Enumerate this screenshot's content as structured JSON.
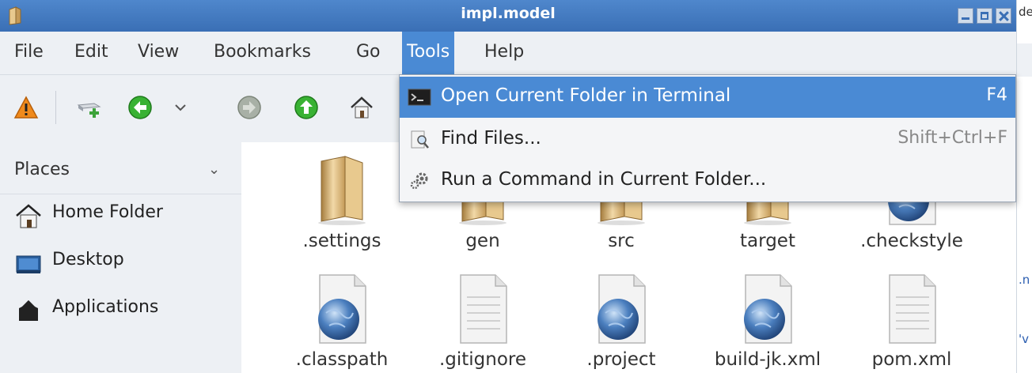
{
  "window": {
    "title": "impl.model"
  },
  "background_window": {
    "title_fragment": "de",
    "text_a": ".n",
    "text_b": "'v"
  },
  "menubar": {
    "items": [
      "File",
      "Edit",
      "View",
      "Bookmarks",
      "Go",
      "Tools",
      "Help"
    ],
    "active": "Tools"
  },
  "tools_menu": {
    "items": [
      {
        "label": "Open Current Folder in Terminal",
        "shortcut": "F4",
        "icon": "terminal-icon",
        "highlighted": true
      },
      {
        "label": "Find Files...",
        "shortcut": "Shift+Ctrl+F",
        "icon": "search-files-icon",
        "highlighted": false
      },
      {
        "label": "Run a Command in Current Folder...",
        "shortcut": "",
        "icon": "gear-icon",
        "highlighted": false
      }
    ]
  },
  "toolbar": {
    "icons": [
      "warning-icon",
      "new-tab-icon",
      "back-icon",
      "history-dropdown-icon",
      "forward-icon",
      "up-icon",
      "home-icon"
    ]
  },
  "sidebar": {
    "header": "Places",
    "items": [
      {
        "label": "Home Folder",
        "icon": "home-folder-icon"
      },
      {
        "label": "Desktop",
        "icon": "desktop-icon"
      },
      {
        "label": "Applications",
        "icon": "applications-icon"
      }
    ]
  },
  "files": {
    "row1": [
      {
        "name": ".settings",
        "kind": "folder"
      },
      {
        "name": "gen",
        "kind": "folder"
      },
      {
        "name": "src",
        "kind": "folder"
      },
      {
        "name": "target",
        "kind": "folder"
      },
      {
        "name": ".checkstyle",
        "kind": "xml"
      }
    ],
    "row2": [
      {
        "name": ".classpath",
        "kind": "xml"
      },
      {
        "name": ".gitignore",
        "kind": "text"
      },
      {
        "name": ".project",
        "kind": "xml"
      },
      {
        "name": "build-jk.xml",
        "kind": "xml"
      },
      {
        "name": "pom.xml",
        "kind": "text"
      }
    ]
  },
  "colors": {
    "titlebar": "#3a6fb5",
    "highlight": "#4a8ad4",
    "chrome": "#edf0f4"
  }
}
